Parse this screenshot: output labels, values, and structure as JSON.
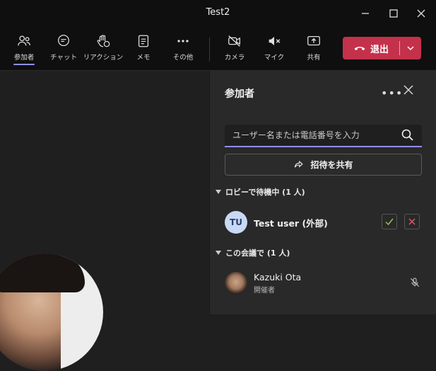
{
  "window": {
    "title": "Test2"
  },
  "toolbar": {
    "people": "参加者",
    "chat": "チャット",
    "reactions": "リアクション",
    "notes": "メモ",
    "more": "その他",
    "camera": "カメラ",
    "mic": "マイク",
    "share": "共有",
    "leave": "退出"
  },
  "panel": {
    "title": "参加者",
    "search_placeholder": "ユーザー名または電話番号を入力",
    "share_invite": "招待を共有",
    "lobby_header": "ロビーで待機中 (1 人)",
    "meeting_header": "この会議で (1 人)",
    "lobby_people": [
      {
        "initials": "TU",
        "name": "Test user (外部)"
      }
    ],
    "meeting_people": [
      {
        "name": "Kazuki Ota",
        "role": "開催者"
      }
    ]
  },
  "colors": {
    "accent": "#8f8fff",
    "leave": "#c4314b",
    "accept": "#92c353",
    "reject": "#e0566b"
  }
}
